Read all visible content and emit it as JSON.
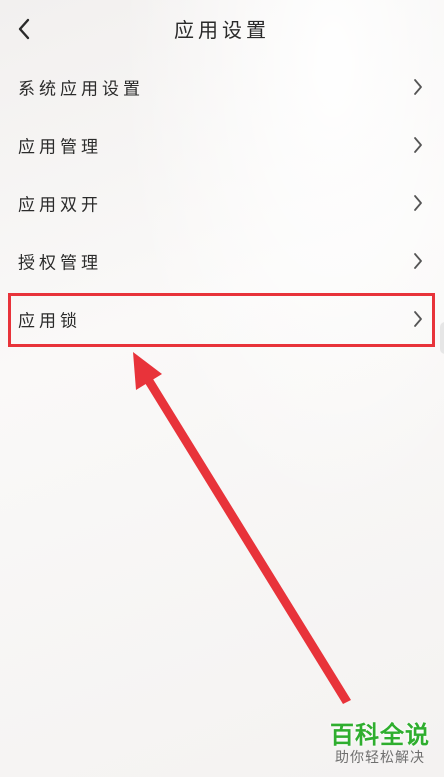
{
  "header": {
    "title": "应用设置",
    "back_icon": "chevron-left-icon"
  },
  "menu": {
    "items": [
      {
        "label": "系统应用设置",
        "icon": "chevron-right-icon"
      },
      {
        "label": "应用管理",
        "icon": "chevron-right-icon"
      },
      {
        "label": "应用双开",
        "icon": "chevron-right-icon"
      },
      {
        "label": "授权管理",
        "icon": "chevron-right-icon"
      },
      {
        "label": "应用锁",
        "icon": "chevron-right-icon"
      }
    ]
  },
  "annotation": {
    "highlight_color": "#e8333a",
    "arrow_color": "#e8333a"
  },
  "watermark": {
    "title": "百科全说",
    "subtitle": "助你轻松解决",
    "title_color": "#2fae2f"
  }
}
